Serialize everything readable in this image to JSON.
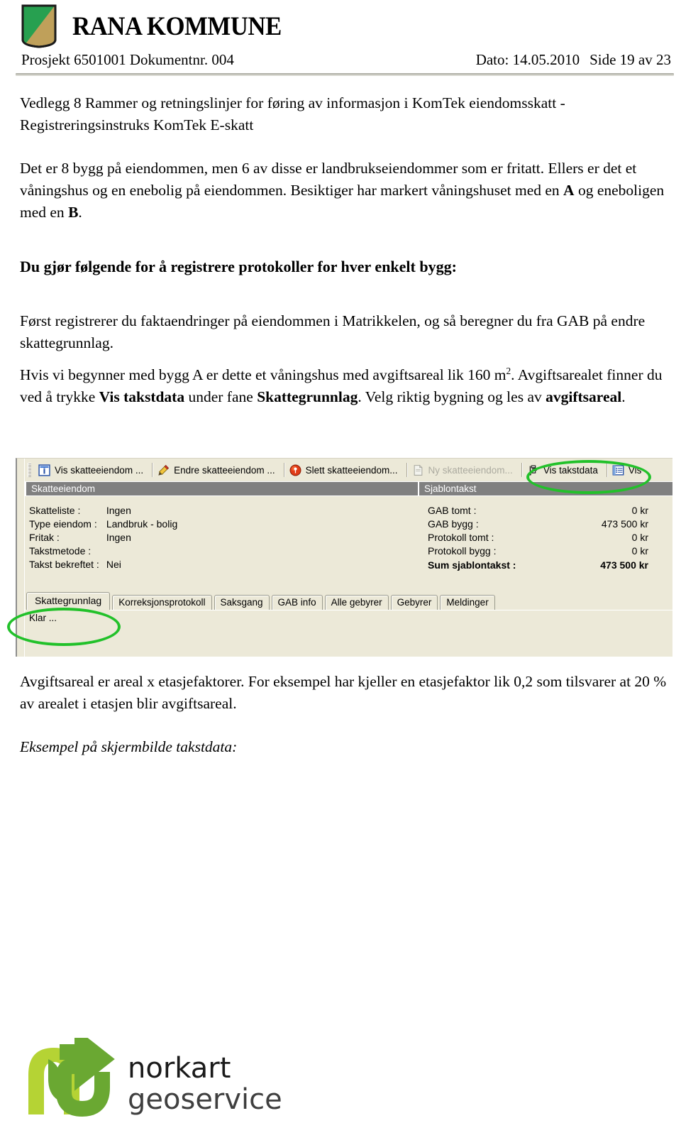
{
  "header": {
    "logo_alt": "Rana Kommune kommunevåpen",
    "kommune_name": "RANA KOMMUNE",
    "project_line": "Prosjekt 6501001 Dokumentnr. 004",
    "date_label": "Dato: 14.05.2010",
    "page_label": "Side 19 av 23",
    "crest_colors": {
      "green": "#27a050",
      "gold": "#bfa05a",
      "outline": "#1a1a1a"
    }
  },
  "document": {
    "title_line_1": "Vedlegg 8 Rammer og retningslinjer for føring av informasjon i KomTek eiendomsskatt -",
    "title_line_2": "Registreringsinstruks KomTek E-skatt",
    "para_1": {
      "t1": "Det er 8 bygg på eiendommen, men 6 av disse er landbrukseiendommer som er fritatt. Ellers er det et våningshus og en enebolig på eiendommen. Besiktiger har markert våningshuset med en ",
      "bold_a": "A",
      "t2": " og eneboligen med en ",
      "bold_b": "B",
      "t3": "."
    },
    "heading_1": "Du gjør følgende for å registrere protokoller for hver enkelt bygg:",
    "para_2": "Først registrerer du faktaendringer på eiendommen i Matrikkelen, og så beregner du fra GAB på endre skattegrunnlag.",
    "para_3": {
      "t1": "Hvis vi begynner med bygg A er dette et våningshus med avgiftsareal lik 160 m",
      "sup": "2",
      "t2": ". Avgiftsarealet finner du ved å trykke ",
      "bold_1": "Vis takstdata",
      "t3": " under fane ",
      "bold_2": "Skattegrunnlag",
      "t4": ". Velg riktig bygning og les av ",
      "bold_3": "avgiftsareal",
      "t5": "."
    },
    "para_4": "Avgiftsareal er areal x etasjefaktorer. For eksempel har kjeller en etasjefaktor lik 0,2 som tilsvarer at 20 % av arealet i etasjen blir avgiftsareal.",
    "caption": "Eksempel på skjermbilde takstdata:"
  },
  "screenshot": {
    "toolbar": [
      {
        "label": "Vis skatteeiendom ...",
        "icon": "info-icon",
        "disabled": false
      },
      {
        "label": "Endre skatteeiendom ...",
        "icon": "pencil-icon",
        "disabled": false
      },
      {
        "label": "Slett skatteeiendom...",
        "icon": "delete-icon",
        "disabled": false
      },
      {
        "label": "Ny skatteeiendom...",
        "icon": "new-doc-icon",
        "disabled": true
      },
      {
        "label": "Vis takstdata",
        "icon": "takstdata-icon",
        "disabled": false
      },
      {
        "label": "Vis",
        "icon": "list-icon",
        "disabled": false
      }
    ],
    "section_left": {
      "title": "Skatteeiendom",
      "rows": [
        {
          "key": "Skatteliste :",
          "value": "Ingen"
        },
        {
          "key": "Type eiendom :",
          "value": "Landbruk - bolig"
        },
        {
          "key": "Fritak :",
          "value": "Ingen"
        },
        {
          "key": "Takstmetode :",
          "value": ""
        },
        {
          "key": "Takst bekreftet :",
          "value": "Nei"
        }
      ]
    },
    "section_right": {
      "title": "Sjablontakst",
      "rows": [
        {
          "key": "GAB tomt :",
          "value": "0 kr",
          "total": false
        },
        {
          "key": "GAB bygg :",
          "value": "473 500 kr",
          "total": false
        },
        {
          "key": "Protokoll tomt :",
          "value": "0 kr",
          "total": false
        },
        {
          "key": "Protokoll bygg :",
          "value": "0 kr",
          "total": false
        },
        {
          "key": "Sum sjablontakst :",
          "value": "473 500 kr",
          "total": true
        }
      ]
    },
    "tabs": [
      {
        "label": "Skattegrunnlag",
        "active": true
      },
      {
        "label": "Korreksjonsprotokoll",
        "active": false
      },
      {
        "label": "Saksgang",
        "active": false
      },
      {
        "label": "GAB info",
        "active": false
      },
      {
        "label": "Alle gebyrer",
        "active": false
      },
      {
        "label": "Gebyrer",
        "active": false
      },
      {
        "label": "Meldinger",
        "active": false
      }
    ],
    "status": "Klar ...",
    "annotation_color": "#22c12a",
    "annotations": [
      {
        "name": "vis-takstdata-highlight",
        "target": "Vis takstdata"
      },
      {
        "name": "skattegrunnlag-highlight",
        "target": "Skattegrunnlag"
      }
    ]
  },
  "footer": {
    "logo_word_1": "norkart",
    "logo_word_2": "geoservice",
    "logo_colors": {
      "light_green": "#b5d334",
      "dark_green": "#6aa832",
      "text": "#1a1a1a"
    }
  }
}
